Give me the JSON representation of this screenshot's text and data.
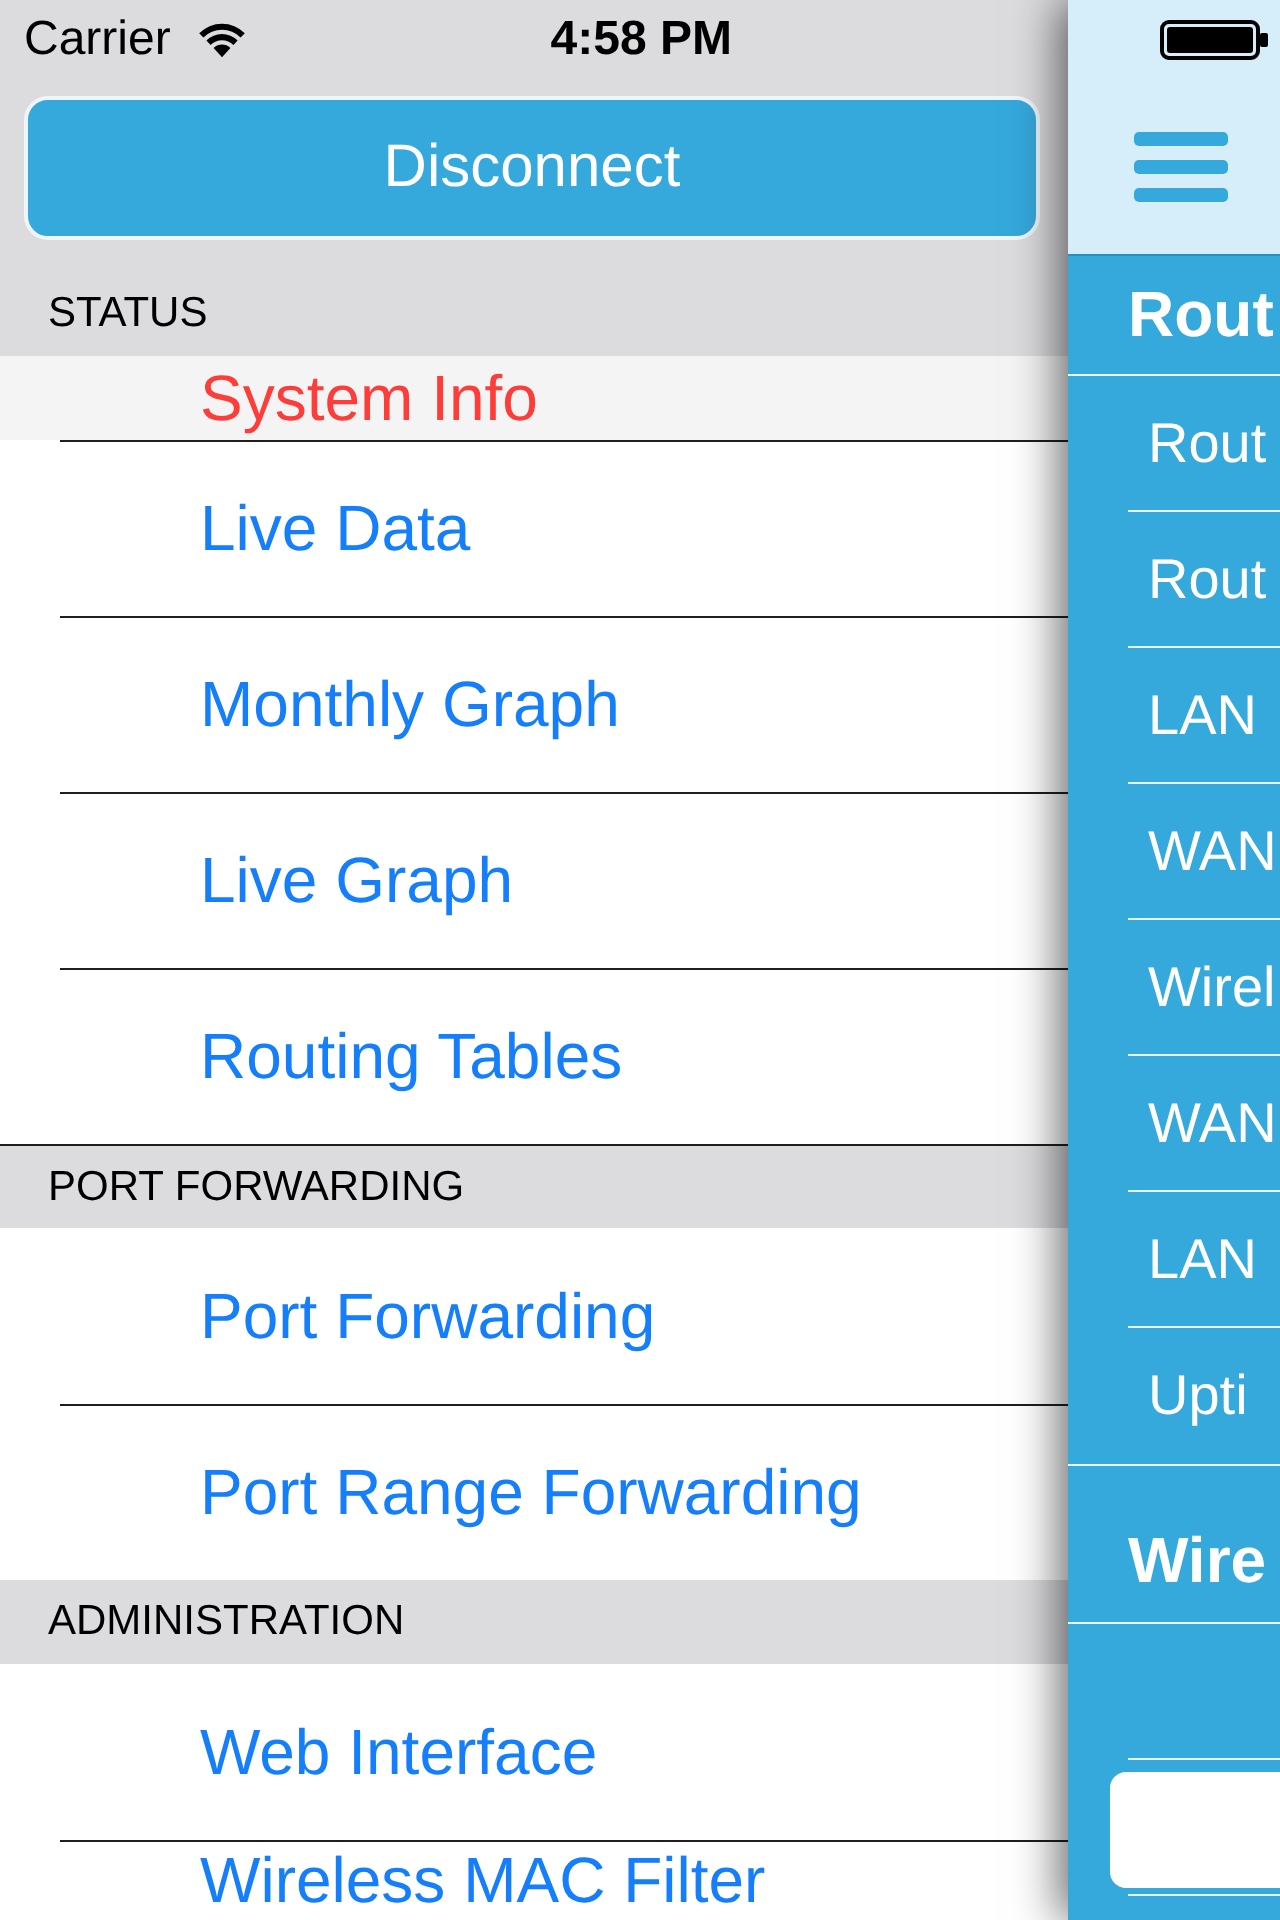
{
  "status_bar": {
    "carrier": "Carrier",
    "time": "4:58 PM"
  },
  "side_menu": {
    "disconnect_button": "Disconnect",
    "sections": [
      {
        "title": "STATUS",
        "items": [
          {
            "label": "System Info",
            "selected": true
          },
          {
            "label": "Live Data",
            "selected": false
          },
          {
            "label": "Monthly Graph",
            "selected": false
          },
          {
            "label": "Live Graph",
            "selected": false
          },
          {
            "label": "Routing Tables",
            "selected": false
          }
        ]
      },
      {
        "title": "PORT FORWARDING",
        "items": [
          {
            "label": "Port Forwarding",
            "selected": false
          },
          {
            "label": "Port Range Forwarding",
            "selected": false
          }
        ]
      },
      {
        "title": "ADMINISTRATION",
        "items": [
          {
            "label": "Web Interface",
            "selected": false
          },
          {
            "label": "Wireless MAC Filter",
            "selected": false
          }
        ]
      }
    ]
  },
  "main_panel": {
    "sections": [
      {
        "title": "Rout",
        "rows": [
          {
            "kind": "text",
            "label": "Rout"
          },
          {
            "kind": "text",
            "label": "Rout"
          },
          {
            "kind": "text",
            "label": "LAN"
          },
          {
            "kind": "text",
            "label": "WAN"
          },
          {
            "kind": "text",
            "label": "Wirel"
          },
          {
            "kind": "text",
            "label": "WAN"
          },
          {
            "kind": "text",
            "label": "LAN"
          },
          {
            "kind": "text",
            "label": "Upti"
          }
        ]
      },
      {
        "title": "Wire",
        "rows": [
          {
            "kind": "empty"
          },
          {
            "kind": "button"
          }
        ]
      }
    ]
  }
}
